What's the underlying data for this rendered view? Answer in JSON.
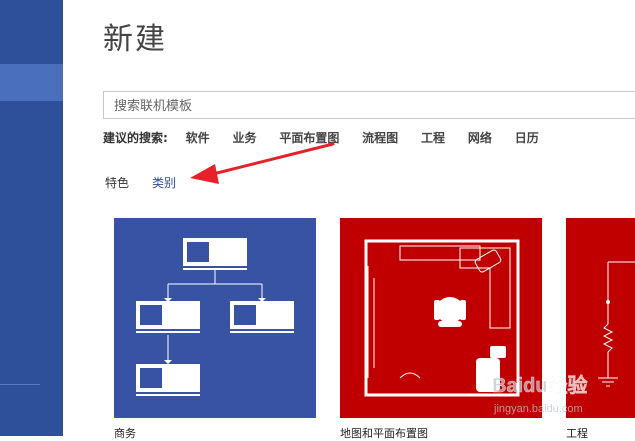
{
  "page": {
    "title": "新建"
  },
  "search": {
    "placeholder": "搜索联机模板"
  },
  "suggestions": {
    "label": "建议的搜索:",
    "items": [
      "软件",
      "业务",
      "平面布置图",
      "流程图",
      "工程",
      "网络",
      "日历"
    ]
  },
  "tabs": {
    "featured": "特色",
    "categories": "类别"
  },
  "templates": [
    {
      "label": "商务"
    },
    {
      "label": "地图和平面布置图"
    },
    {
      "label": "工程"
    }
  ],
  "watermark": {
    "brand": "Baidu经验",
    "url": "jingyan.baidu.com"
  },
  "colors": {
    "sidebar": "#2e4f9a",
    "sidebar_highlight": "#4a6fbd",
    "tile_business": "#3953a4",
    "tile_floorplan": "#c00000",
    "arrow": "#e8202a",
    "link": "#2e4f9a"
  }
}
